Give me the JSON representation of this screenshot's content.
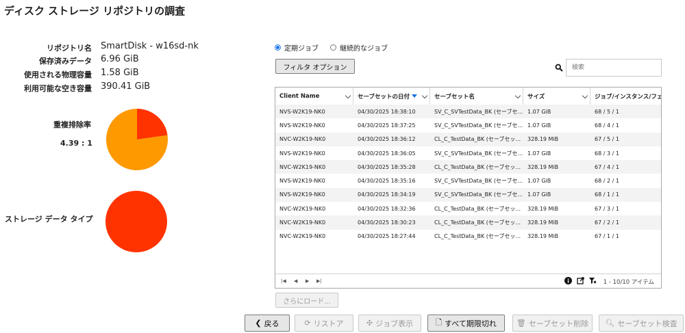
{
  "title": "ディスク ストレージ リポジトリの調査",
  "info": [
    {
      "label": "リポジトリ名",
      "value": "SmartDisk - w16sd-nk"
    },
    {
      "label": "保存済みデータ",
      "value": "6.96 GiB"
    },
    {
      "label": "使用される物理容量",
      "value": "1.58 GiB"
    },
    {
      "label": "利用可能な空き容量",
      "value": "390.41 GiB"
    }
  ],
  "dedup": {
    "label": "重複排除率",
    "ratio": "4.39 : 1",
    "ratio_value": 4.39
  },
  "storage_type": {
    "label": "ストレージ データ タイプ"
  },
  "colors": {
    "pie_primary": "#ff3300",
    "pie_secondary": "#ff9900",
    "accent": "#1a73e8"
  },
  "job_type": {
    "options": [
      {
        "label": "定期ジョブ",
        "selected": true
      },
      {
        "label": "継続的なジョブ",
        "selected": false
      }
    ]
  },
  "filter_button": "フィルタ オプション",
  "search": {
    "placeholder": "検索",
    "value": ""
  },
  "table": {
    "columns": [
      "Client Name",
      "セーブセットの日付",
      "セーブセット名",
      "サイズ",
      "ジョブ/インスタンス/フェ"
    ],
    "rows": [
      [
        "NVS-W2K19-NK0",
        "04/30/2025 18:38:10",
        "SV_C_SVTestData_BK (セーブセ...",
        "1.07 GiB",
        "68 / 5 / 1"
      ],
      [
        "NVS-W2K19-NK0",
        "04/30/2025 18:37:25",
        "SV_C_SVTestData_BK (セーブセ...",
        "1.07 GiB",
        "68 / 4 / 1"
      ],
      [
        "NVC-W2K19-NK0",
        "04/30/2025 18:36:12",
        "CL_C_TestData_BK (セーブセッ...",
        "328.19 MiB",
        "67 / 5 / 1"
      ],
      [
        "NVS-W2K19-NK0",
        "04/30/2025 18:36:05",
        "SV_C_SVTestData_BK (セーブセ...",
        "1.07 GiB",
        "68 / 3 / 1"
      ],
      [
        "NVC-W2K19-NK0",
        "04/30/2025 18:35:28",
        "CL_C_TestData_BK (セーブセッ...",
        "328.19 MiB",
        "67 / 4 / 1"
      ],
      [
        "NVS-W2K19-NK0",
        "04/30/2025 18:35:16",
        "SV_C_SVTestData_BK (セーブセ...",
        "1.07 GiB",
        "68 / 2 / 1"
      ],
      [
        "NVS-W2K19-NK0",
        "04/30/2025 18:34:19",
        "SV_C_SVTestData_BK (セーブセ...",
        "1.07 GiB",
        "68 / 1 / 1"
      ],
      [
        "NVC-W2K19-NK0",
        "04/30/2025 18:32:36",
        "CL_C_TestData_BK (セーブセッ...",
        "328.19 MiB",
        "67 / 3 / 1"
      ],
      [
        "NVC-W2K19-NK0",
        "04/30/2025 18:30:23",
        "CL_C_TestData_BK (セーブセッ...",
        "328.19 MiB",
        "67 / 2 / 1"
      ],
      [
        "NVC-W2K19-NK0",
        "04/30/2025 18:27:44",
        "CL_C_TestData_BK (セーブセッ...",
        "328.19 MiB",
        "67 / 1 / 1"
      ]
    ],
    "page_info": "1 - 10/10 アイテム"
  },
  "load_more": "さらにロード...",
  "buttons": {
    "back": "戻る",
    "restore": "リストア",
    "job_view": "ジョブ表示",
    "expire_all": "すべて期限切れ",
    "delete_saveset": "セーブセット削除",
    "inspect_saveset": "セーブセット検査"
  }
}
